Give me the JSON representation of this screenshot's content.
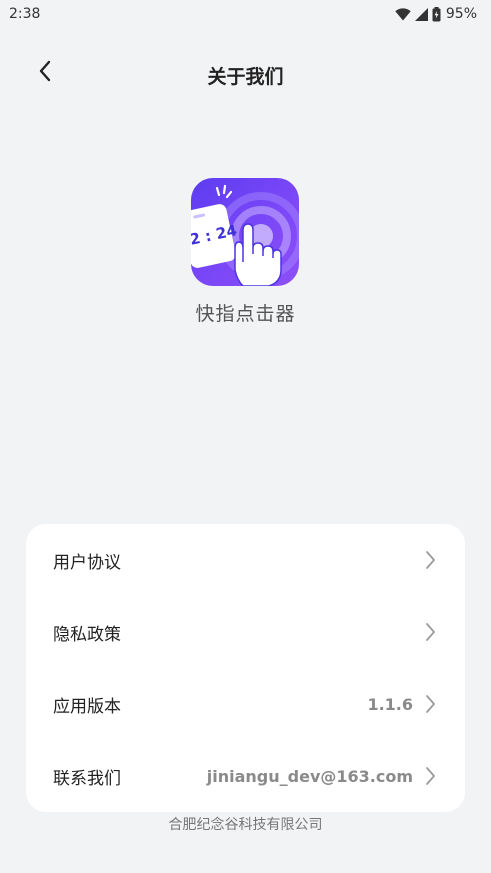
{
  "status_bar": {
    "time": "2:38",
    "battery": "95%",
    "icons": [
      "wifi-icon",
      "signal-icon",
      "battery-icon"
    ]
  },
  "header": {
    "title": "关于我们",
    "back_icon": "chevron-left-icon"
  },
  "app": {
    "name": "快指点击器",
    "icon_clock_text": "2 : 24",
    "colors": {
      "icon_gradient_start": "#5b3df0",
      "icon_gradient_end": "#8e4ff8"
    }
  },
  "settings": {
    "items": [
      {
        "label": "用户协议",
        "value": ""
      },
      {
        "label": "隐私政策",
        "value": ""
      },
      {
        "label": "应用版本",
        "value": "1.1.6"
      },
      {
        "label": "联系我们",
        "value": "jiniangu_dev@163.com"
      }
    ]
  },
  "footer": {
    "company": "合肥纪念谷科技有限公司"
  }
}
